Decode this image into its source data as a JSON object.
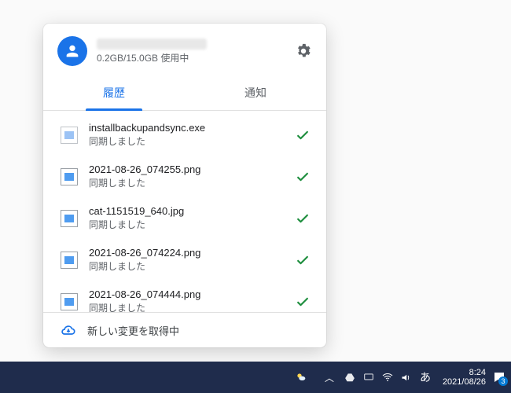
{
  "account": {
    "storage_line": "0.2GB/15.0GB 使用中"
  },
  "tabs": {
    "history": "履歴",
    "notifications": "通知"
  },
  "status_synced": "同期しました",
  "items": [
    {
      "name": "installbackupandsync.exe",
      "kind": "exe"
    },
    {
      "name": "2021-08-26_074255.png",
      "kind": "img"
    },
    {
      "name": "cat-1151519_640.jpg",
      "kind": "img"
    },
    {
      "name": "2021-08-26_074224.png",
      "kind": "img"
    },
    {
      "name": "2021-08-26_074444.png",
      "kind": "img"
    }
  ],
  "footer": {
    "fetching": "新しい変更を取得中"
  },
  "taskbar": {
    "time": "8:24",
    "date": "2021/08/26",
    "ime": "あ",
    "notif_count": "3"
  }
}
